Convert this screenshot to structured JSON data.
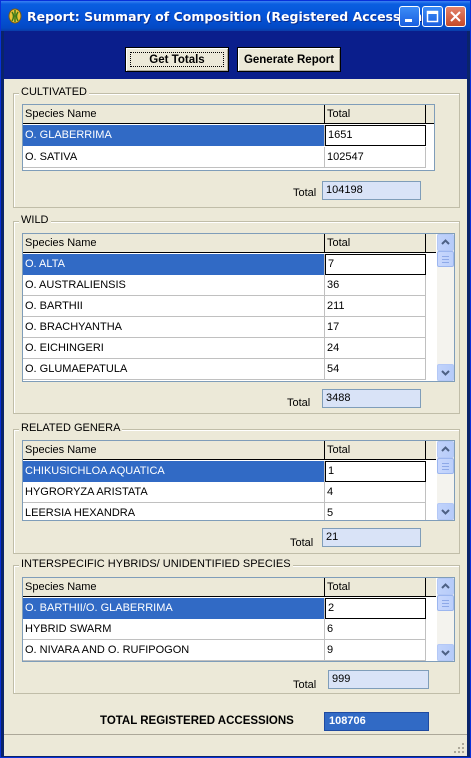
{
  "window": {
    "title": "Report: Summary of Composition (Registered Accessions)"
  },
  "toolbar": {
    "get_totals_label": "Get Totals",
    "generate_report_label": "Generate Report"
  },
  "columns": {
    "species": "Species Name",
    "total": "Total"
  },
  "total_label": "Total",
  "cultivated": {
    "label": "CULTIVATED",
    "rows": [
      {
        "name": "O. GLABERRIMA",
        "total": "1651"
      },
      {
        "name": "O. SATIVA",
        "total": "102547"
      }
    ],
    "total": "104198"
  },
  "wild": {
    "label": "WILD",
    "rows": [
      {
        "name": "O. ALTA",
        "total": "7"
      },
      {
        "name": "O. AUSTRALIENSIS",
        "total": "36"
      },
      {
        "name": "O. BARTHII",
        "total": "211"
      },
      {
        "name": "O. BRACHYANTHA",
        "total": "17"
      },
      {
        "name": "O. EICHINGERI",
        "total": "24"
      },
      {
        "name": "O. GLUMAEPATULA",
        "total": "54"
      }
    ],
    "total": "3488"
  },
  "related": {
    "label": "RELATED GENERA",
    "rows": [
      {
        "name": "CHIKUSICHLOA AQUATICA",
        "total": "1"
      },
      {
        "name": "HYGRORYZA ARISTATA",
        "total": "4"
      },
      {
        "name": "LEERSIA HEXANDRA",
        "total": "5"
      }
    ],
    "total": "21"
  },
  "hybrids": {
    "label": "INTERSPECIFIC HYBRIDS/ UNIDENTIFIED SPECIES",
    "rows": [
      {
        "name": "O. BARTHII/O. GLABERRIMA",
        "total": "2"
      },
      {
        "name": "HYBRID SWARM",
        "total": "6"
      },
      {
        "name": "O. NIVARA AND O. RUFIPOGON",
        "total": "9"
      }
    ],
    "total": "999"
  },
  "grand_total": {
    "label": "TOTAL REGISTERED ACCESSIONS",
    "value": "108706"
  },
  "colors": {
    "selection": "#316ac5",
    "titlebar": "#0453d8",
    "toolbar_band": "#0a1e8c",
    "total_box": "#d9e3f7"
  },
  "icons": [
    "app-icon",
    "minimize-icon",
    "maximize-icon",
    "close-icon",
    "scroll-up-icon",
    "scroll-down-icon",
    "resize-grip-icon"
  ]
}
